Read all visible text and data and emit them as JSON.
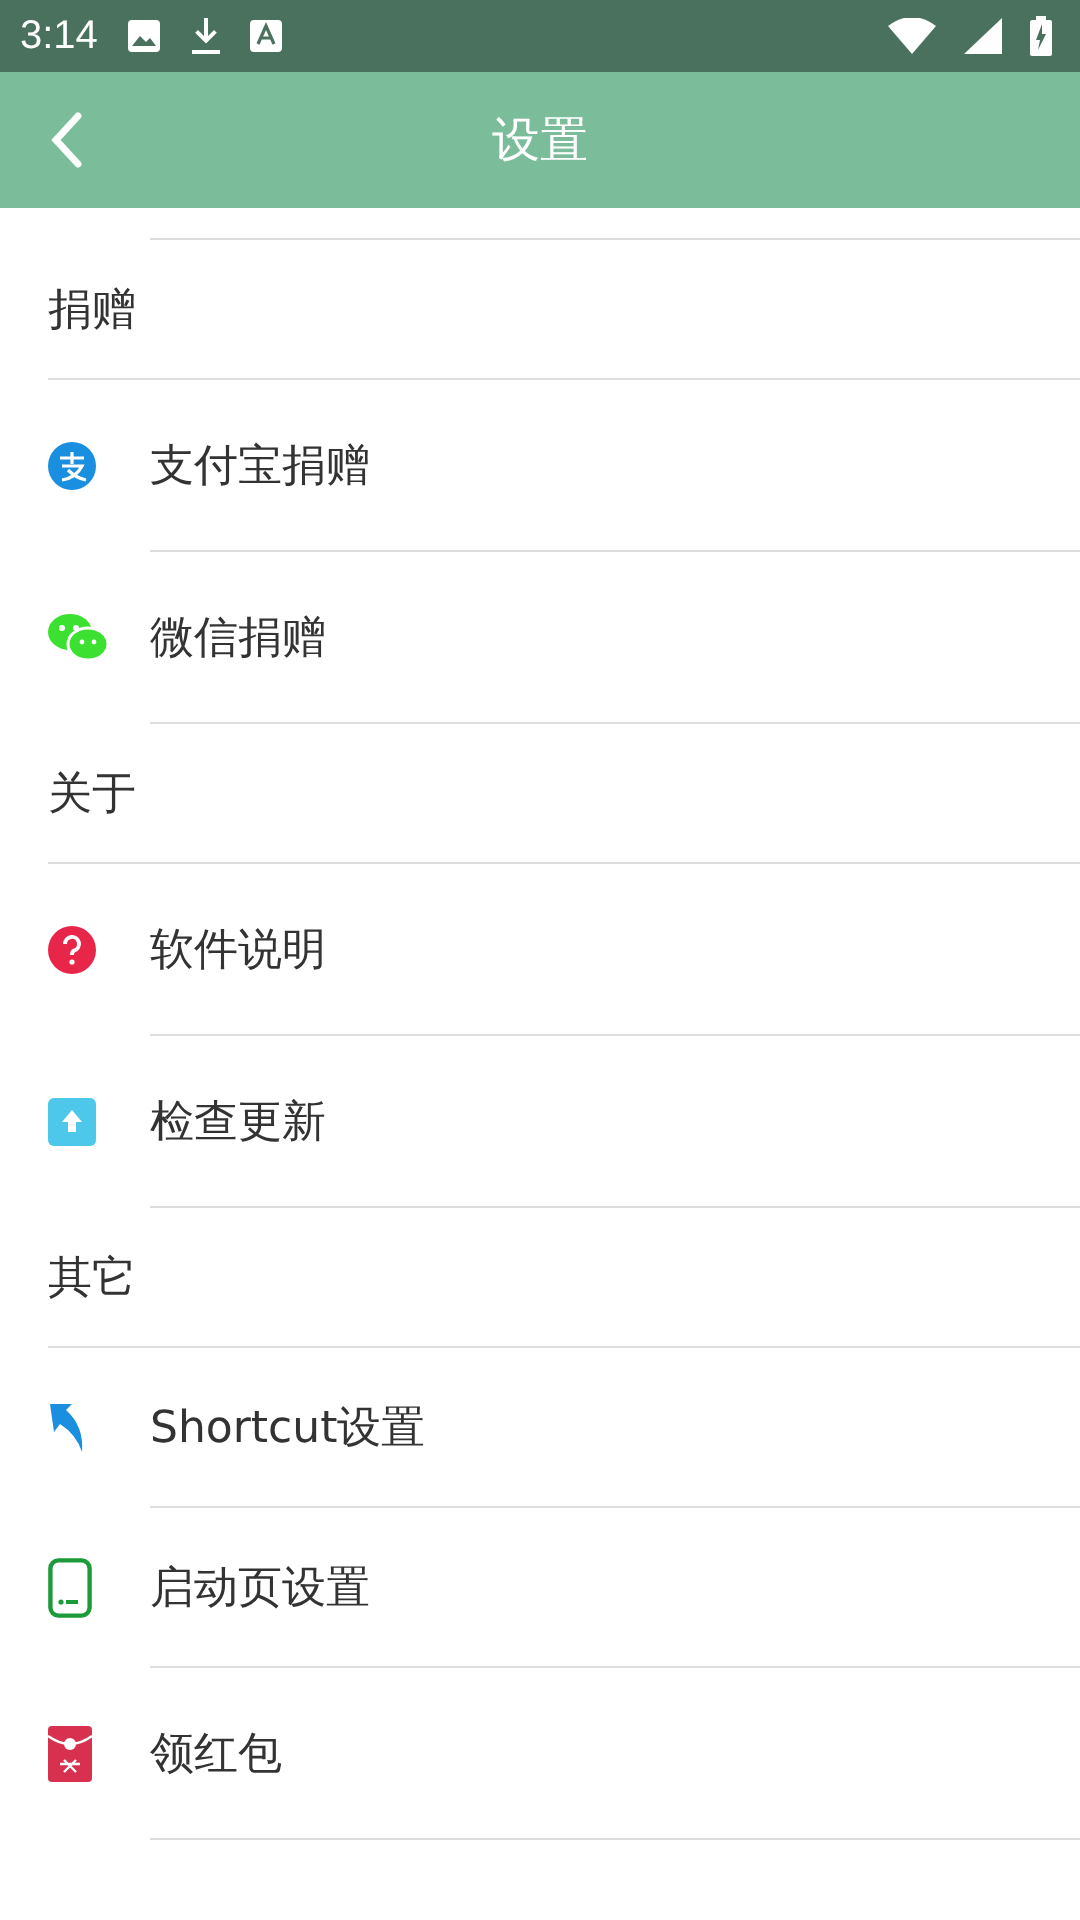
{
  "status_bar": {
    "time": "3:14"
  },
  "app_bar": {
    "title": "设置"
  },
  "sections": [
    {
      "header": "捐赠",
      "items": [
        {
          "kind": "alipay",
          "label": "支付宝捐赠"
        },
        {
          "kind": "wechat",
          "label": "微信捐赠"
        }
      ]
    },
    {
      "header": "关于",
      "items": [
        {
          "kind": "help",
          "label": "软件说明"
        },
        {
          "kind": "update",
          "label": "检查更新"
        }
      ]
    },
    {
      "header": "其它",
      "items": [
        {
          "kind": "shortcut",
          "label": "Shortcut设置"
        },
        {
          "kind": "splash",
          "label": "启动页设置"
        },
        {
          "kind": "redpacket",
          "label": "领红包"
        }
      ]
    }
  ]
}
